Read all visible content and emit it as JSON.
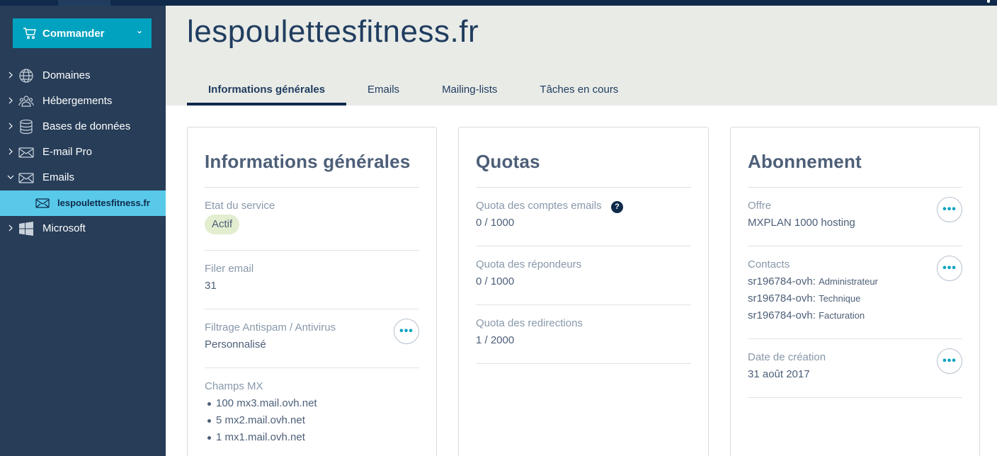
{
  "sidebar": {
    "order_label": "Commander",
    "items": [
      {
        "label": "Domaines",
        "icon": "globe-icon"
      },
      {
        "label": "Hébergements",
        "icon": "users-icon"
      },
      {
        "label": "Bases de données",
        "icon": "database-icon"
      },
      {
        "label": "E-mail Pro",
        "icon": "envelope-icon"
      },
      {
        "label": "Emails",
        "icon": "envelope-icon"
      }
    ],
    "sub_item": {
      "label": "lespoulettesfitness.fr",
      "icon": "envelope-icon"
    },
    "last_item": {
      "label": "Microsoft",
      "icon": "windows-icon"
    }
  },
  "header": {
    "title": "lespoulettesfitness.fr",
    "tabs": [
      {
        "label": "Informations générales"
      },
      {
        "label": "Emails"
      },
      {
        "label": "Mailing-lists"
      },
      {
        "label": "Tâches en cours"
      }
    ]
  },
  "general": {
    "title": "Informations générales",
    "state_label": "Etat du service",
    "state_value": "Actif",
    "filer_label": "Filer email",
    "filer_value": "31",
    "filter_label": "Filtrage Antispam / Antivirus",
    "filter_value": "Personnalisé",
    "mx_label": "Champs MX",
    "mx": [
      "100 mx3.mail.ovh.net",
      "5 mx2.mail.ovh.net",
      "1 mx1.mail.ovh.net"
    ]
  },
  "quotas": {
    "title": "Quotas",
    "accounts_label": "Quota des comptes emails",
    "accounts_value": "0 / 1000",
    "responders_label": "Quota des répondeurs",
    "responders_value": "0 / 1000",
    "redirections_label": "Quota des redirections",
    "redirections_value": "1 / 2000"
  },
  "subscription": {
    "title": "Abonnement",
    "offer_label": "Offre",
    "offer_value": "MXPLAN 1000 hosting",
    "contacts_label": "Contacts",
    "contacts": [
      {
        "id": "sr196784-ovh:",
        "role": "Administrateur"
      },
      {
        "id": "sr196784-ovh:",
        "role": "Technique"
      },
      {
        "id": "sr196784-ovh:",
        "role": "Facturation"
      }
    ],
    "created_label": "Date de création",
    "created_value": "31 août 2017"
  },
  "colors": {
    "accent": "#00a2bf",
    "sidebar": "#273d58",
    "selected": "#59c9ea",
    "navy": "#0f2a4a"
  }
}
